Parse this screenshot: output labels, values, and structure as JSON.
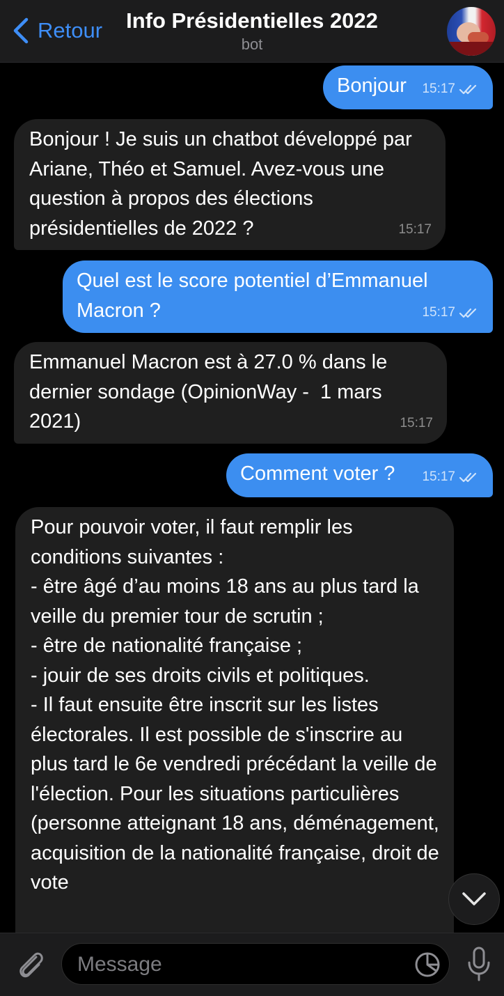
{
  "header": {
    "back_label": "Retour",
    "title": "Info Présidentielles 2022",
    "subtitle": "bot"
  },
  "messages": [
    {
      "direction": "out",
      "text": "Bonjour",
      "time": "15:17",
      "read": true
    },
    {
      "direction": "in",
      "text": "Bonjour ! Je suis un chatbot développé par Ariane, Théo et Samuel. Avez-vous une question à propos des élections présidentielles de 2022 ?",
      "time": "15:17"
    },
    {
      "direction": "out",
      "text": "Quel est le score potentiel d’Emmanuel Macron ?",
      "time": "15:17",
      "read": true
    },
    {
      "direction": "in",
      "text": "Emmanuel Macron est à 27.0 % dans le dernier sondage (OpinionWay -  1 mars 2021)",
      "time": "15:17"
    },
    {
      "direction": "out",
      "text": "Comment voter ?",
      "time": "15:17",
      "read": true
    },
    {
      "direction": "in",
      "text": "Pour pouvoir voter, il faut remplir les conditions suivantes :\n- être âgé d’au moins 18 ans au plus tard la veille du premier tour de scrutin ;\n- être de nationalité française ;\n- jouir de ses droits civils et politiques.\n- Il faut ensuite être inscrit sur les listes électorales. Il est possible de s'inscrire au plus tard le 6e vendredi précédant la veille de l'élection. Pour les situations particulières (personne atteignant 18 ans, déménagement, acquisition de la nationalité française, droit de vote"
    }
  ],
  "input": {
    "placeholder": "Message"
  },
  "icons": {
    "back": "chevron-left-icon",
    "avatar": "bot-avatar",
    "read_receipt": "double-check-icon",
    "scroll_down": "chevron-down-icon",
    "attach": "paperclip-icon",
    "sticker": "sticker-icon",
    "mic": "microphone-icon"
  },
  "colors": {
    "accent": "#3e8ef7",
    "outgoing_bubble": "#3c8ef0",
    "incoming_bubble": "#1f1f1f",
    "background": "#000000",
    "bar": "#1c1c1d"
  }
}
